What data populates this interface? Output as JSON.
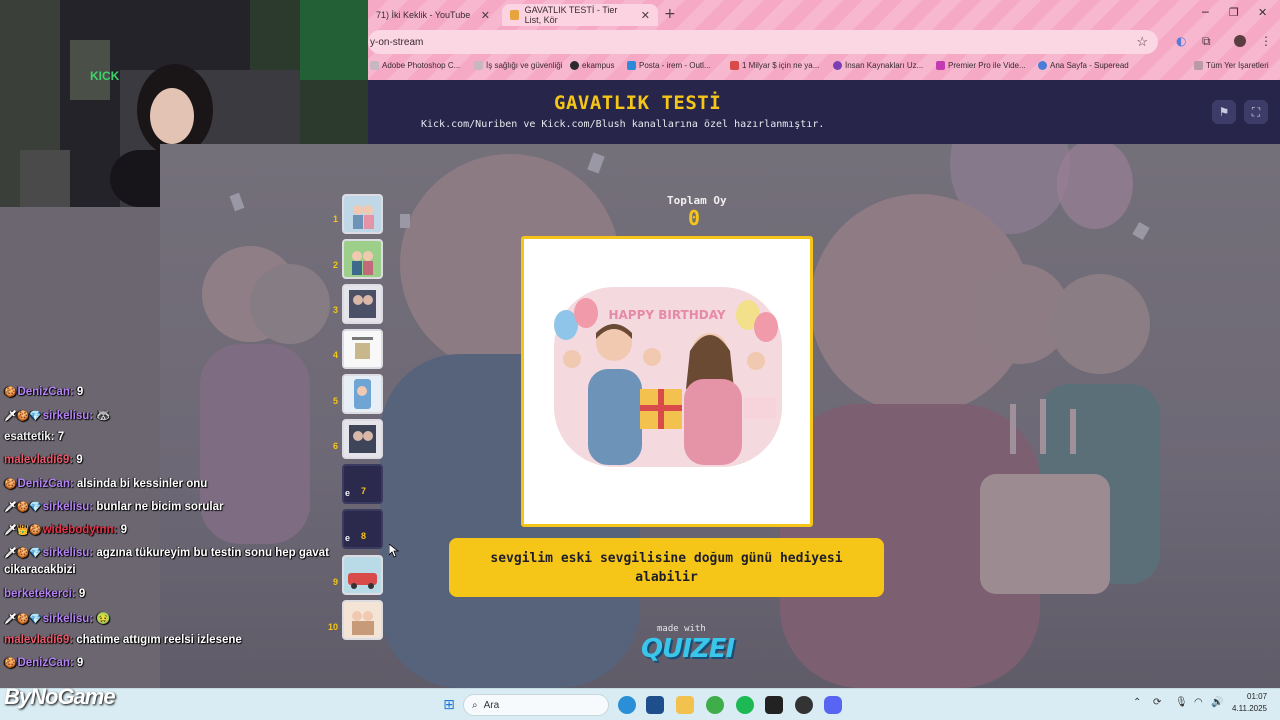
{
  "browser": {
    "tabs": [
      {
        "label": "71) İki Keklik - YouTube"
      },
      {
        "label": "GAVATLIK TESTİ - Tier List, Kör"
      }
    ],
    "url": "y-on-stream",
    "bookmarks": [
      {
        "label": "Adobe Photoshop C..."
      },
      {
        "label": "İş sağlığı ve güvenliği"
      },
      {
        "label": "ekampus"
      },
      {
        "label": "Posta - irem - Outl..."
      },
      {
        "label": "1 Milyar $ için ne ya..."
      },
      {
        "label": "İnsan Kaynakları Uz..."
      },
      {
        "label": "Premier Pro ile Vide..."
      },
      {
        "label": "Ana Sayfa - Superead"
      },
      {
        "label": "Tüm Yer İşaretleri"
      }
    ]
  },
  "quiz": {
    "title": "GAVATLIK TESTİ",
    "subtitle": "Kick.com/Nuriben ve Kick.com/Blush kanallarına özel hazırlanmıştır.",
    "votes_label": "Toplam Oy",
    "votes_value": "0",
    "image_text": "HAPPY BIRTHDAY",
    "statement": "sevgilim eski sevgilisine doğum günü hediyesi alabilir",
    "made_with": "made with",
    "logo": "QUIZEI",
    "thumbnails": [
      {
        "num": "1",
        "type": "image"
      },
      {
        "num": "2",
        "type": "image"
      },
      {
        "num": "3",
        "type": "image"
      },
      {
        "num": "4",
        "type": "image"
      },
      {
        "num": "5",
        "type": "image"
      },
      {
        "num": "6",
        "type": "image"
      },
      {
        "num": "7",
        "type": "empty",
        "e": "e"
      },
      {
        "num": "8",
        "type": "empty",
        "e": "e"
      },
      {
        "num": "9",
        "type": "image"
      },
      {
        "num": "10",
        "type": "image"
      }
    ]
  },
  "chat": {
    "messages": [
      {
        "user": "DenizCan:",
        "text": "9",
        "color": "#b583f5"
      },
      {
        "user": "sirkelisu:",
        "text": "🦝",
        "color": "#b583f5"
      },
      {
        "user": "esattetik:",
        "text": "7",
        "color": "#f0f0f0"
      },
      {
        "user": "malevladi69:",
        "text": "9",
        "color": "#e85a6b"
      },
      {
        "user": "DenizCan:",
        "text": "alsinda bi kessinler onu",
        "color": "#b583f5"
      },
      {
        "user": "sirkelisu:",
        "text": "bunlar ne bicim sorular",
        "color": "#b583f5"
      },
      {
        "user": "widebodytnn:",
        "text": "9",
        "color": "#e8334a"
      },
      {
        "user": "sirkelisu:",
        "text": "agzına tükureyim bu testin sonu hep gavat",
        "color": "#b583f5"
      },
      {
        "user": "",
        "text": "cikaracakbizi",
        "color": "#f0f0f0"
      },
      {
        "user": "berketekerci:",
        "text": "9",
        "color": "#b583f5"
      },
      {
        "user": "sirkelisu:",
        "text": "🤢",
        "color": "#b583f5"
      },
      {
        "user": "malevladi69:",
        "text": "chatime attıgım reelsi izlesene",
        "color": "#e85a6b"
      },
      {
        "user": "DenizCan:",
        "text": "9",
        "color": "#b583f5"
      }
    ]
  },
  "taskbar": {
    "search_placeholder": "Ara",
    "time": "01:07",
    "date": "4.11.2025",
    "overlay_brand": "ByNoGame"
  }
}
